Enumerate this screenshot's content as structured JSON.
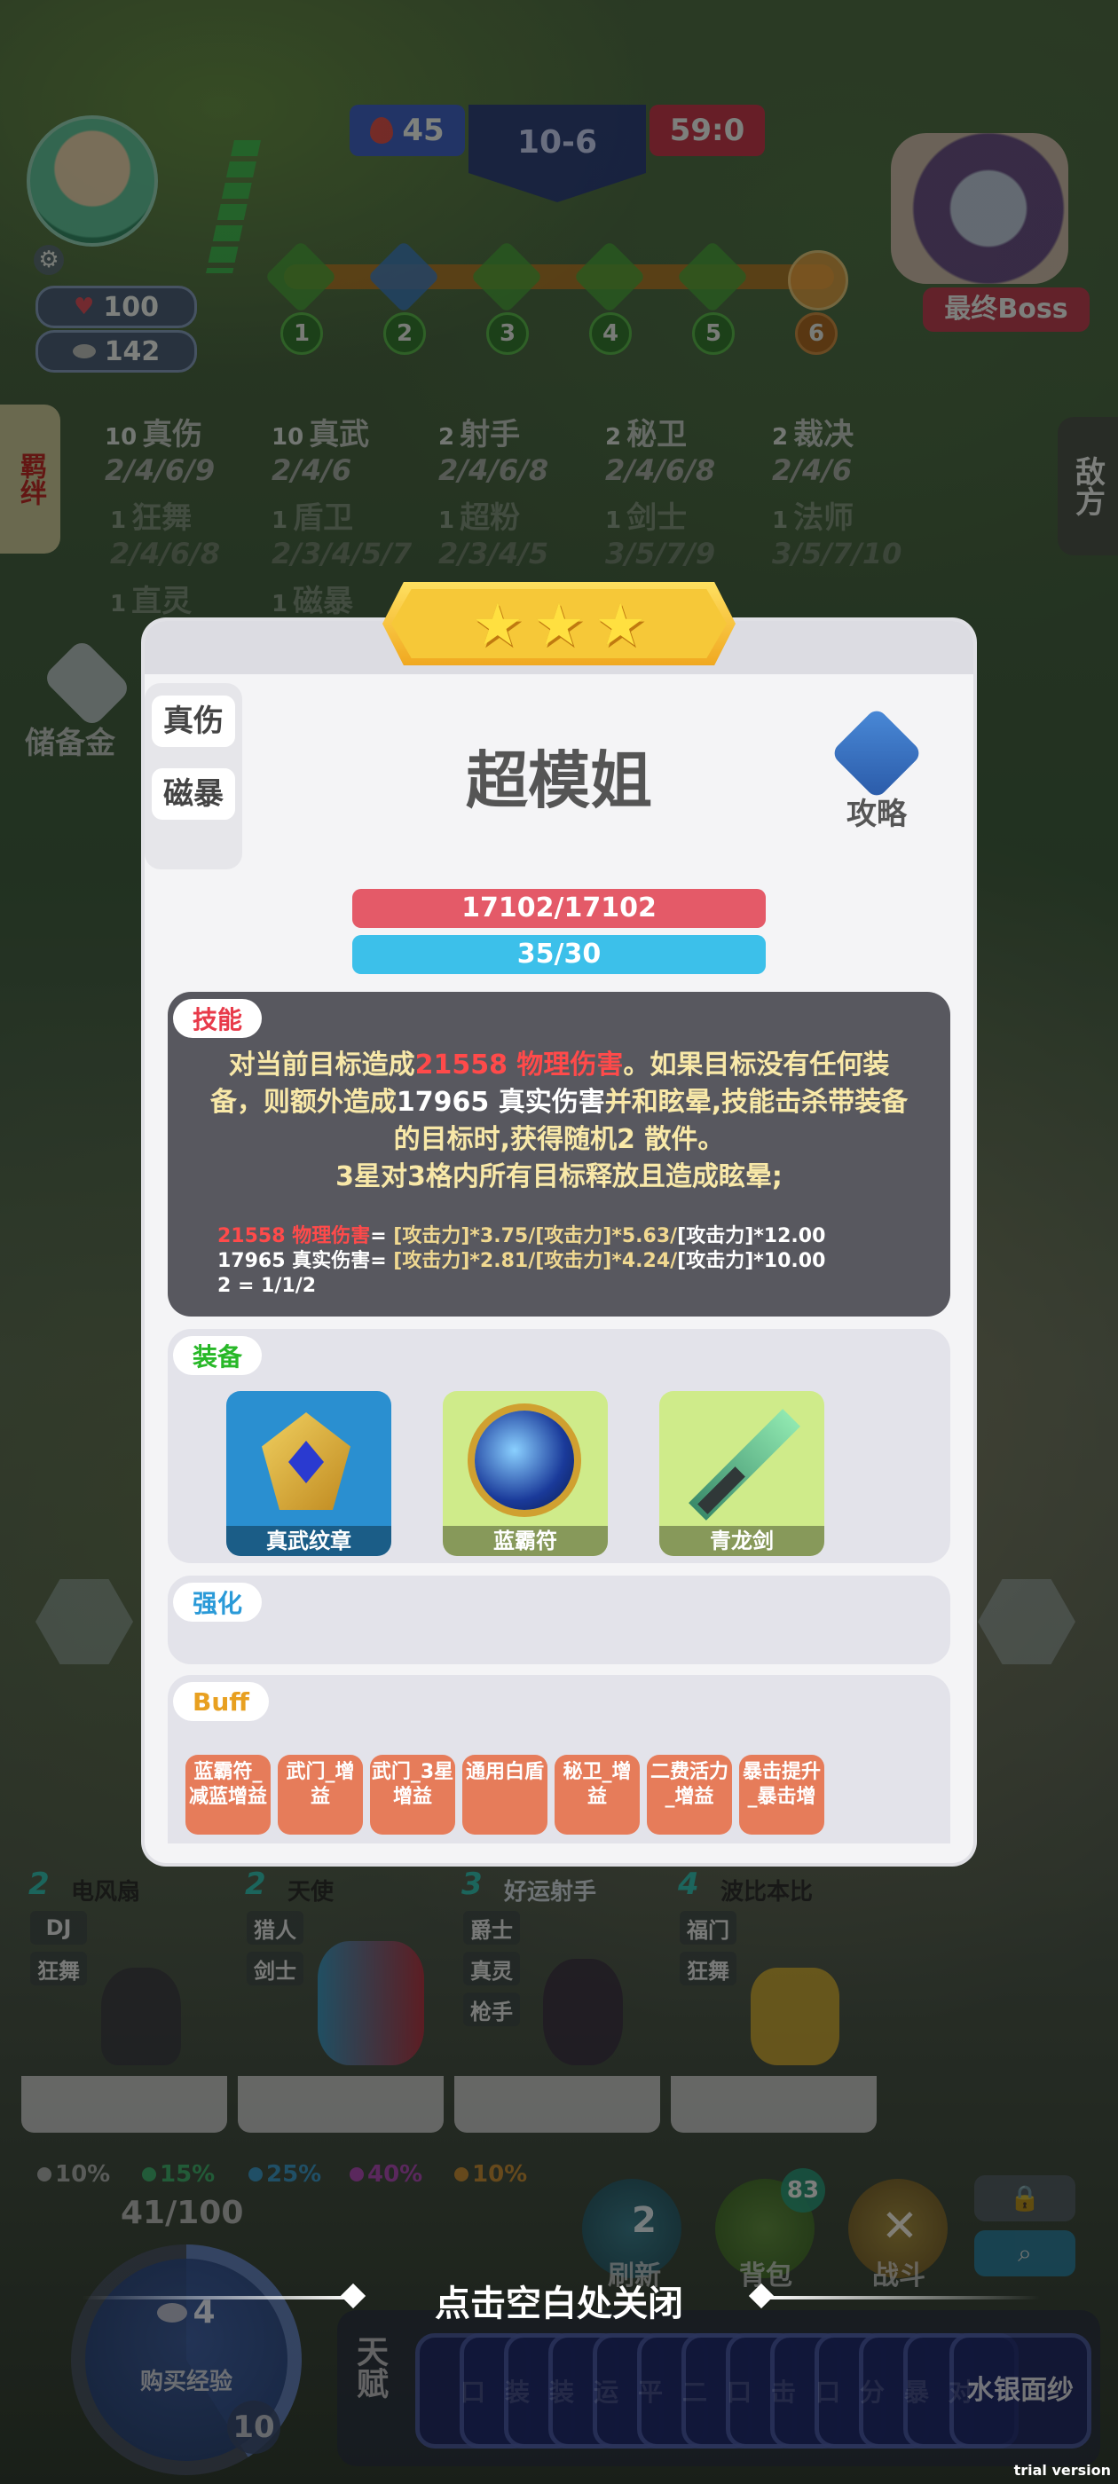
{
  "player": {
    "hp": "100",
    "gold": "142"
  },
  "topbar": {
    "streak": "45",
    "stage": "10-6",
    "timer": "59:0"
  },
  "stages": [
    "1",
    "2",
    "3",
    "4",
    "5",
    "6"
  ],
  "boss": {
    "label": "最终Boss"
  },
  "side_tabs": {
    "synergy": "羁绊",
    "enemy": "敌方"
  },
  "piggy": {
    "label": "储备金"
  },
  "synergies_row1": [
    {
      "count": "10",
      "name": "真伤",
      "tiers": "2/4/6/9"
    },
    {
      "count": "10",
      "name": "真武",
      "tiers": "2/4/6"
    },
    {
      "count": "2",
      "name": "射手",
      "tiers": "2/4/6/8"
    },
    {
      "count": "2",
      "name": "秘卫",
      "tiers": "2/4/6/8"
    },
    {
      "count": "2",
      "name": "裁决",
      "tiers": "2/4/6"
    }
  ],
  "synergies_row2": [
    {
      "count": "1",
      "name": "狂舞",
      "tiers": "2/4/6/8"
    },
    {
      "count": "1",
      "name": "盾卫",
      "tiers": "2/3/4/5/7"
    },
    {
      "count": "1",
      "name": "超粉",
      "tiers": "2/3/4/5"
    },
    {
      "count": "1",
      "name": "剑士",
      "tiers": "3/5/7/9"
    },
    {
      "count": "1",
      "name": "法师",
      "tiers": "3/5/7/10"
    }
  ],
  "synergies_row3": [
    {
      "count": "1",
      "name": "直灵"
    },
    {
      "count": "1",
      "name": "磁暴"
    }
  ],
  "modal": {
    "stars": 3,
    "trait_tags": [
      "真伤",
      "磁暴"
    ],
    "hero_name": "超模姐",
    "guide_label": "攻略",
    "hp_text": "17102/17102",
    "mana_text": "35/30",
    "hp_fraction": 1.0,
    "mana_fraction": 1.0,
    "skill": {
      "tag": "技能",
      "desc_pre": "对当前目标造成",
      "desc_dmg": "21558 物理伤害",
      "desc_rest1": "。如果目标没有任何装备，则额外造成",
      "desc_true": "17965 真实伤害",
      "desc_rest2": "并和眩晕,技能击杀带装备的目标时,获得随机2 散件。",
      "desc_line4": "3星对3格内所有目标释放且造成眩晕;",
      "formula1_label": "21558 物理伤害",
      "formula1_eq": "= ",
      "formula1_vals": "[攻击力]*3.75/[攻击力]*5.63/",
      "formula1_end": "[攻击力]*12.00",
      "formula2_label": "17965 真实伤害",
      "formula2_eq": "= ",
      "formula2_vals": "[攻击力]*2.81/[攻击力]*4.24/",
      "formula2_end": "[攻击力]*10.00",
      "formula3": "2 = 1/1/2"
    },
    "equip": {
      "tag": "装备",
      "items": [
        {
          "name": "真武纹章",
          "bg": "#2a8fd0"
        },
        {
          "name": "蓝霸符",
          "bg": "#cfeb8a"
        },
        {
          "name": "青龙剑",
          "bg": "#cfeb8a"
        }
      ]
    },
    "enhance": {
      "tag": "强化"
    },
    "buff": {
      "tag": "Buff",
      "items": [
        "蓝霸符_减蓝增益",
        "武门_增益",
        "武门_3星增益",
        "通用白盾",
        "秘卫_增益",
        "二费活力_增益",
        "暴击提升_暴击增"
      ]
    }
  },
  "shop": {
    "cards": [
      {
        "cost": "2",
        "name": "电风扇",
        "traits": [
          "DJ",
          "狂舞"
        ],
        "bg": "#a5c63a"
      },
      {
        "cost": "2",
        "name": "天使",
        "traits": [
          "猎人",
          "剑士"
        ],
        "bg": "#9fbb3b"
      },
      {
        "cost": "3",
        "name": "好运射手",
        "traits": [
          "爵士",
          "真灵",
          "枪手"
        ],
        "bg": "#3a95b5"
      },
      {
        "cost": "4",
        "name": "波比本比",
        "traits": [
          "福门",
          "狂舞"
        ],
        "bg": "#9a5fb0"
      }
    ],
    "odds": [
      {
        "value": "10%",
        "color": "#cfcfcf"
      },
      {
        "value": "15%",
        "color": "#3ed07a"
      },
      {
        "value": "25%",
        "color": "#3ab0f0"
      },
      {
        "value": "40%",
        "color": "#d04ad8"
      },
      {
        "value": "10%",
        "color": "#f0a030"
      }
    ]
  },
  "xp": {
    "text": "41/100",
    "fraction": 0.41,
    "cost": "4",
    "label": "购买经验",
    "level": "10"
  },
  "actions": {
    "refresh_cost": "2",
    "refresh": "刷新",
    "bag_count": "83",
    "bag": "背包",
    "battle": "战斗"
  },
  "close_hint": "点击空白处关闭",
  "talent": {
    "label": "天赋",
    "cards": [
      "口",
      "装",
      "装",
      "运",
      "平",
      "二",
      "口",
      "击",
      "口",
      "分",
      "暴",
      "对"
    ],
    "last": "水银面纱"
  },
  "watermark": "trial version"
}
